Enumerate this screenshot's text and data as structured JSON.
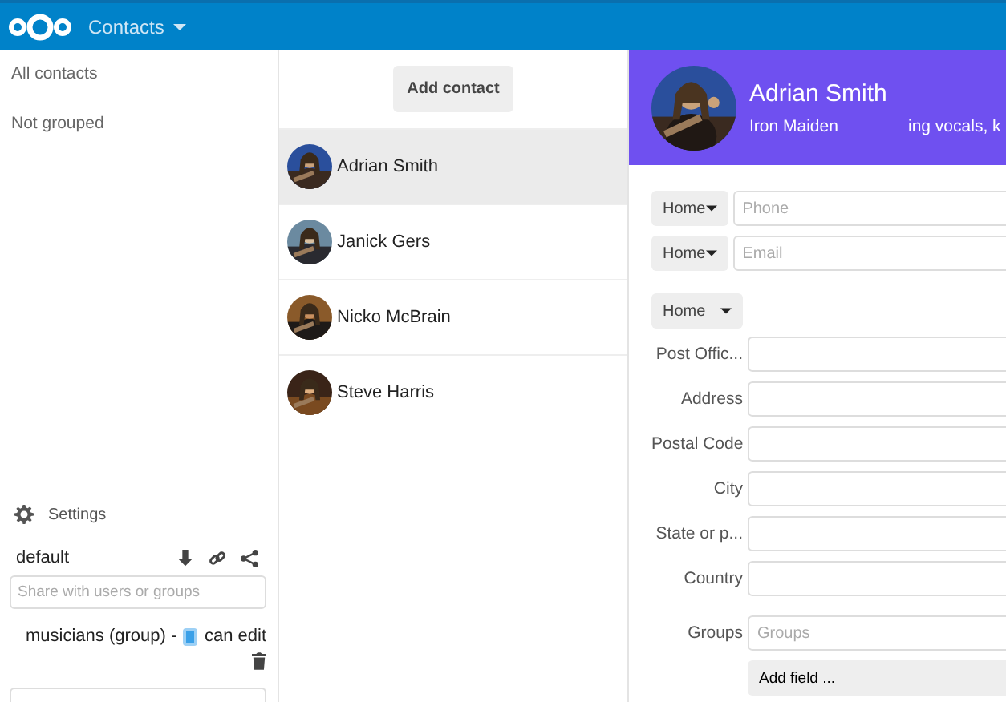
{
  "header": {
    "app_title": "Contacts"
  },
  "sidebar": {
    "items": [
      {
        "label": "All contacts",
        "selected": false
      },
      {
        "label": "Not grouped",
        "selected": false
      }
    ],
    "settings": {
      "label": "Settings"
    },
    "addressbook": {
      "name": "default",
      "share_placeholder": "Share with users or groups",
      "shares": [
        {
          "name": "musicians (group) -",
          "can_edit": true,
          "permission_label": "can edit"
        }
      ]
    }
  },
  "contact_list": {
    "add_button": "Add contact",
    "contacts": [
      {
        "name": "Adrian Smith",
        "selected": true
      },
      {
        "name": "Janick Gers",
        "selected": false
      },
      {
        "name": "Nicko McBrain",
        "selected": false
      },
      {
        "name": "Steve Harris",
        "selected": false
      }
    ]
  },
  "details": {
    "name": "Adrian Smith",
    "org": "Iron Maiden",
    "title": "ing vocals, k",
    "typed_fields": [
      {
        "type": "Home",
        "placeholder": "Phone"
      },
      {
        "type": "Home",
        "placeholder": "Email"
      }
    ],
    "address_type": "Home",
    "address_fields": [
      {
        "label": "Post Offic..."
      },
      {
        "label": "Address"
      },
      {
        "label": "Postal Code"
      },
      {
        "label": "City"
      },
      {
        "label": "State or p..."
      },
      {
        "label": "Country"
      }
    ],
    "groups": {
      "label": "Groups",
      "placeholder": "Groups"
    },
    "add_field": "Add field ..."
  }
}
